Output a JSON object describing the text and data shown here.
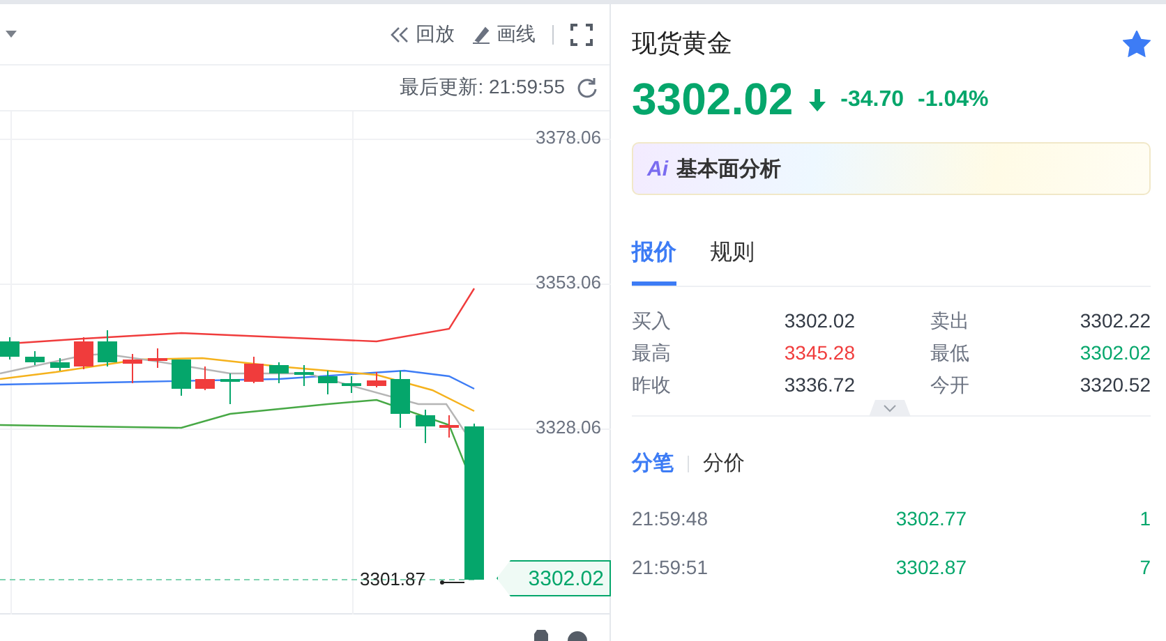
{
  "toolbar": {
    "buttons": [
      {
        "kind": "replay",
        "label": "回放"
      },
      {
        "kind": "draw",
        "label": "画线"
      }
    ]
  },
  "last_update": "最后更新: 21:59:55",
  "chart": {
    "y_labels": [
      "3378.06",
      "3353.06",
      "3328.06"
    ],
    "low_marker": "3301.87",
    "last_price_tag": "3302.02"
  },
  "quote": {
    "title": "现货黄金",
    "favorite": true,
    "price": "3302.02",
    "color": "#05a66b",
    "change": "-34.70",
    "change_percent": "-1.04%",
    "ai_badge": "Ai",
    "ai_banner": "基本面分析"
  },
  "tabs": [
    {
      "label": "报价",
      "selected": true
    },
    {
      "label": "规则",
      "selected": false
    }
  ],
  "stats": [
    {
      "label": "买入",
      "value": "3302.02",
      "color": "#333a45"
    },
    {
      "label": "卖出",
      "value": "3302.22",
      "color": "#333a45"
    },
    {
      "label": "最高",
      "value": "3345.28",
      "color": "#f03c3c"
    },
    {
      "label": "最低",
      "value": "3302.02",
      "color": "#05a66b"
    },
    {
      "label": "昨收",
      "value": "3336.72",
      "color": "#333a45"
    },
    {
      "label": "今开",
      "value": "3320.52",
      "color": "#333a45"
    }
  ],
  "trade_tabs": [
    {
      "label": "分笔",
      "selected": true
    },
    {
      "label": "分价",
      "selected": false
    }
  ],
  "trades": [
    {
      "time": "21:59:48",
      "price": "3302.77",
      "volume": "1",
      "color": "#05a66b"
    },
    {
      "time": "21:59:51",
      "price": "3302.87",
      "volume": "7",
      "color": "#05a66b"
    }
  ]
}
